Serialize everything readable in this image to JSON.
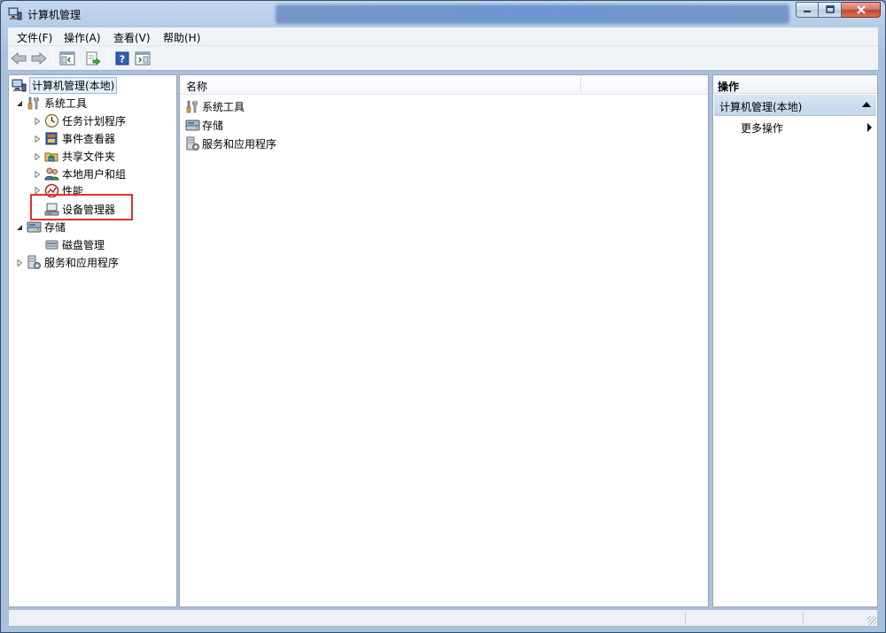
{
  "window": {
    "title": "计算机管理",
    "caption_buttons": [
      "minimize-icon",
      "maximize-icon",
      "close-icon"
    ]
  },
  "menu": [
    "文件(F)",
    "操作(A)",
    "查看(V)",
    "帮助(H)"
  ],
  "toolbar": {
    "buttons": [
      "back-arrow-icon",
      "forward-arrow-icon",
      "show-hide-console-tree-icon",
      "export-list-icon",
      "help-icon",
      "show-hide-action-pane-icon"
    ]
  },
  "tree": {
    "root": "计算机管理(本地)",
    "system_tools": "系统工具",
    "task_scheduler": "任务计划程序",
    "event_viewer": "事件查看器",
    "shared_folders": "共享文件夹",
    "local_users": "本地用户和组",
    "performance": "性能",
    "device_manager": "设备管理器",
    "storage": "存储",
    "disk_management": "磁盘管理",
    "services_apps": "服务和应用程序"
  },
  "list": {
    "column_name": "名称",
    "rows": [
      "系统工具",
      "存储",
      "服务和应用程序"
    ]
  },
  "actions": {
    "header": "操作",
    "group": "计算机管理(本地)",
    "more": "更多操作"
  },
  "colors": {
    "highlight": "#e0302e",
    "selection": "#e5eefb",
    "window_frame": "#b6cce6"
  }
}
